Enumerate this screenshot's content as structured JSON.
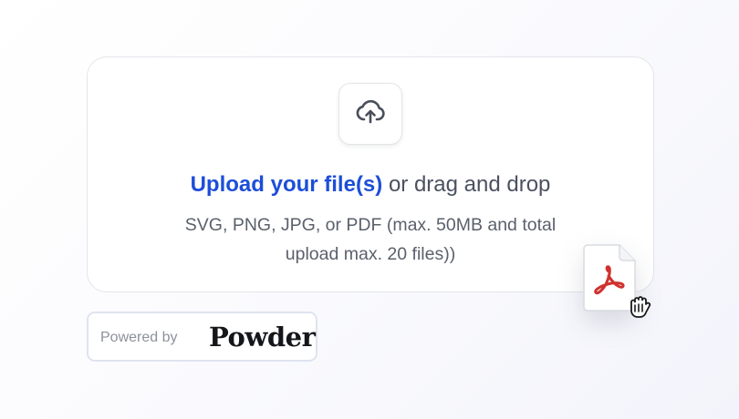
{
  "upload": {
    "link_label": "Upload your file(s)",
    "rest_label": " or drag and drop",
    "hint_line1": "SVG, PNG, JPG, or PDF (max. 50MB and total",
    "hint_line2": "upload max. 20 files))",
    "icon": "cloud-upload-icon"
  },
  "dragged_file": {
    "icon": "pdf-file-icon",
    "cursor": "grab-hand-cursor-icon",
    "accent_color": "#d0312d"
  },
  "badge": {
    "powered_by": "Powered by",
    "brand": "Powder"
  },
  "colors": {
    "link": "#1d4ed8",
    "text": "#4b5160",
    "border": "#e3e5ea"
  }
}
